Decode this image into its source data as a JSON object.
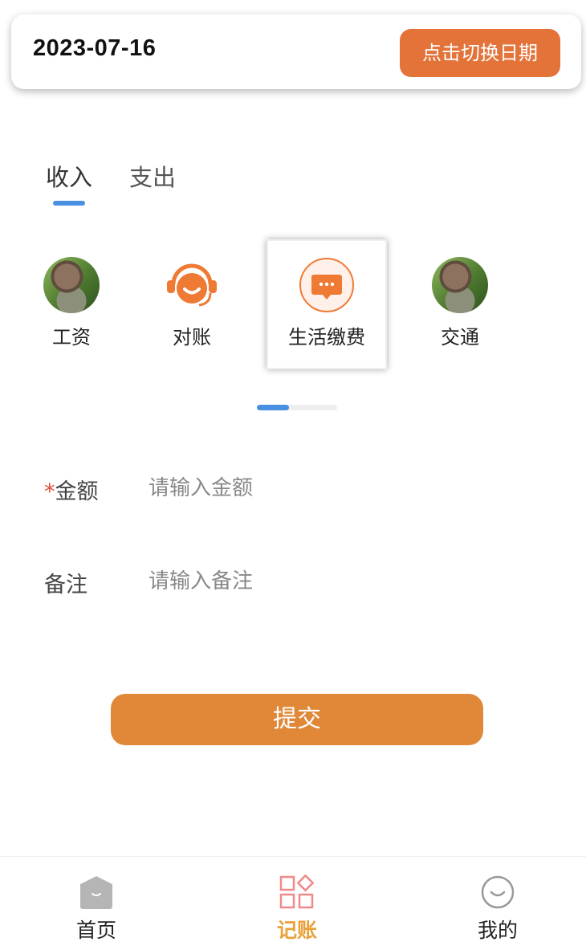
{
  "header": {
    "date": "2023-07-16",
    "switch_date_label": "点击切换日期"
  },
  "tabs": [
    {
      "label": "收入",
      "active": true
    },
    {
      "label": "支出",
      "active": false
    }
  ],
  "categories": [
    {
      "label": "工资",
      "icon": "snail-photo-icon",
      "selected": false
    },
    {
      "label": "对账",
      "icon": "smiley-headset-icon",
      "selected": false
    },
    {
      "label": "生活缴费",
      "icon": "chat-bubble-icon",
      "selected": true
    },
    {
      "label": "交通",
      "icon": "snail-photo-icon",
      "selected": false
    }
  ],
  "category_scroll_progress": 0.4,
  "form": {
    "amount": {
      "required_mark": "*",
      "label": "金额",
      "placeholder": "请输入金额",
      "value": ""
    },
    "note": {
      "label": "备注",
      "placeholder": "请输入备注",
      "value": ""
    },
    "submit_label": "提交"
  },
  "bottom_nav": [
    {
      "label": "首页",
      "icon": "home-icon",
      "active": false
    },
    {
      "label": "记账",
      "icon": "grid-icon",
      "active": true
    },
    {
      "label": "我的",
      "icon": "smile-face-icon",
      "active": false
    }
  ],
  "colors": {
    "accent_orange": "#e4733a",
    "submit_orange": "#e08838",
    "tab_blue": "#4a90e2",
    "nav_active": "#e9a23b",
    "required_red": "#e04a3a"
  }
}
